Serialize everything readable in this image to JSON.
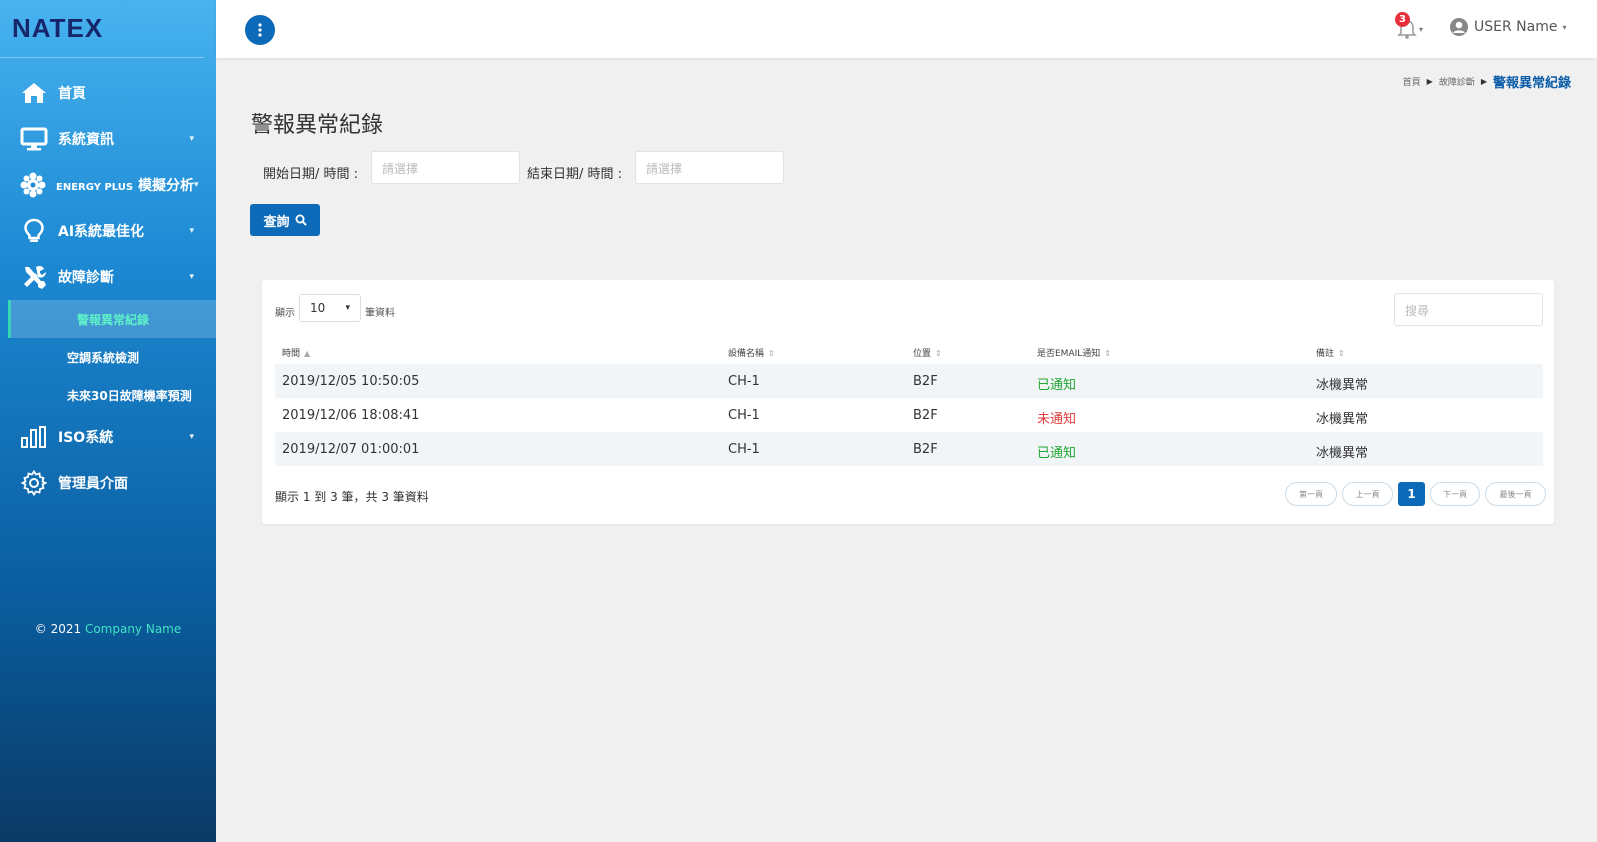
{
  "brand": {
    "logo": "NATEX",
    "logo_first": "N",
    "logo_rest": "ATEX"
  },
  "sidebar": {
    "items": [
      {
        "label": "首頁",
        "icon": "home-icon"
      },
      {
        "label": "系統資訊",
        "icon": "monitor-icon"
      },
      {
        "label": "ENERGY PLUS 模擬分析",
        "label_a": "ENERGY PLUS",
        "label_b": "模擬分析",
        "icon": "gear-flower-icon"
      },
      {
        "label": "AI系統最佳化",
        "icon": "lightbulb-icon"
      },
      {
        "label": "故障診斷",
        "icon": "tools-icon"
      },
      {
        "label": "ISO系統",
        "icon": "bar-chart-icon"
      },
      {
        "label": "管理員介面",
        "icon": "settings-icon"
      }
    ],
    "subitems": [
      {
        "label": "警報異常紀錄",
        "active": true
      },
      {
        "label": "空調系統檢測"
      },
      {
        "label": "未來30日故障機率預測"
      }
    ],
    "caret": "▾",
    "footer_prefix": "© 2021",
    "footer_company": "Company Name"
  },
  "topbar": {
    "notification_count": "3",
    "user_name": "USER Name"
  },
  "breadcrumb": {
    "home": "首頁",
    "section": "故障診斷",
    "current": "警報異常紀錄",
    "sep": "▶"
  },
  "page_title": "警報異常紀錄",
  "filters": {
    "start_label": "開始日期/ 時間 :",
    "start_placeholder": "請選擇",
    "end_label": "結束日期/ 時間 :",
    "end_placeholder": "請選擇",
    "query_button": "查詢"
  },
  "table": {
    "length_prefix": "顯示",
    "length_value": "10",
    "length_suffix": "筆資料",
    "search_placeholder": "搜尋",
    "columns": [
      "時間",
      "設備名稱",
      "位置",
      "是否EMAIL通知",
      "備註"
    ],
    "rows": [
      [
        "2019/12/05 10:50:05",
        "CH-1",
        "B2F",
        "已通知",
        "冰機異常"
      ],
      [
        "2019/12/06 18:08:41",
        "CH-1",
        "B2F",
        "未通知",
        "冰機異常"
      ],
      [
        "2019/12/07 01:00:01",
        "CH-1",
        "B2F",
        "已通知",
        "冰機異常"
      ]
    ],
    "info": "顯示 1 到 3 筆，共 3 筆資料",
    "pager": {
      "first": "第一頁",
      "prev": "上一頁",
      "current": "1",
      "next": "下一頁",
      "last": "最後一頁"
    }
  }
}
